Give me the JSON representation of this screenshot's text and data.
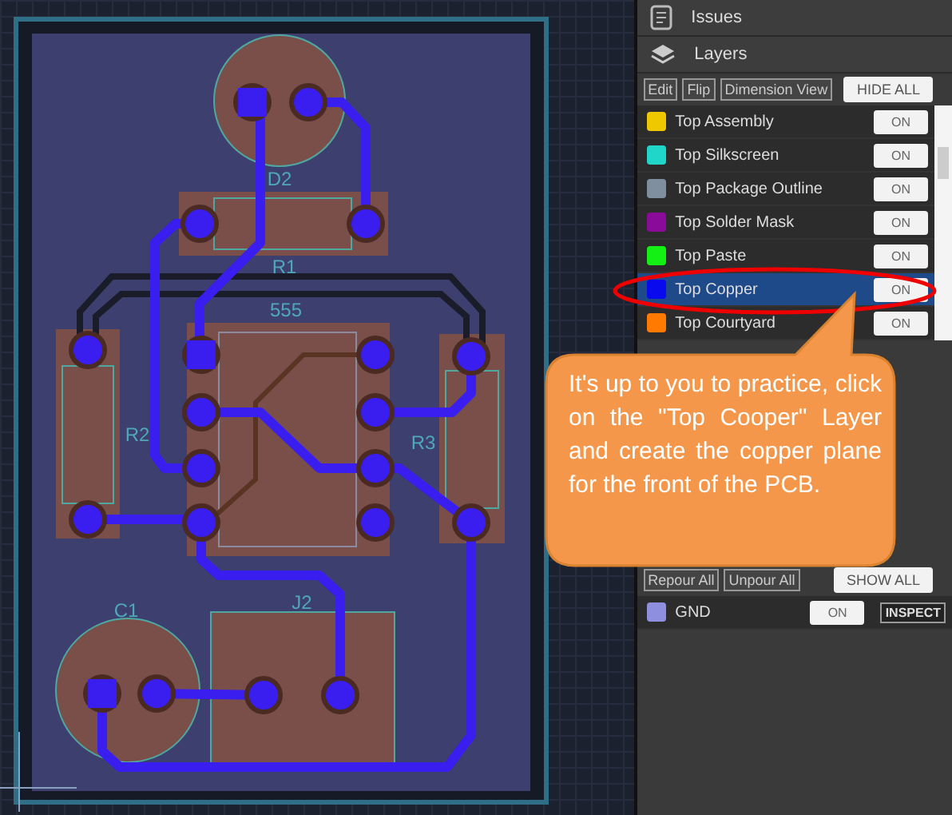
{
  "panel_sections": [
    {
      "kind": "issues",
      "label": "Issues"
    },
    {
      "kind": "layers",
      "label": "Layers"
    }
  ],
  "layer_toolbar": {
    "buttons": [
      "Edit",
      "Flip",
      "Dimension View"
    ],
    "toggle_all": "HIDE ALL"
  },
  "layers": [
    {
      "name": "Top Assembly",
      "color": "#f0c800",
      "toggle": "ON",
      "selected": false
    },
    {
      "name": "Top Silkscreen",
      "color": "#1fd6c8",
      "toggle": "ON",
      "selected": false
    },
    {
      "name": "Top Package Outline",
      "color": "#7f8fa0",
      "toggle": "ON",
      "selected": false
    },
    {
      "name": "Top Solder Mask",
      "color": "#8a0a9a",
      "toggle": "ON",
      "selected": false
    },
    {
      "name": "Top Paste",
      "color": "#14f014",
      "toggle": "ON",
      "selected": false
    },
    {
      "name": "Top Copper",
      "color": "#0a0aee",
      "toggle": "ON",
      "selected": true
    },
    {
      "name": "Top Courtyard",
      "color": "#ff7a00",
      "toggle": "ON",
      "selected": false
    }
  ],
  "callout": {
    "text": "It's up to you to practice, click on the \"Top Cooper\" Layer and create the copper plane for the front of the PCB."
  },
  "nets_toolbar": {
    "buttons": [
      "Repour All",
      "Unpour All"
    ],
    "toggle_all": "SHOW ALL"
  },
  "nets": [
    {
      "name": "GND",
      "color": "#8f8fe0",
      "toggle": "ON",
      "action": "INSPECT"
    }
  ],
  "board": {
    "labels": [
      "D2",
      "R1",
      "555",
      "R2",
      "R3",
      "C1",
      "J2"
    ]
  }
}
